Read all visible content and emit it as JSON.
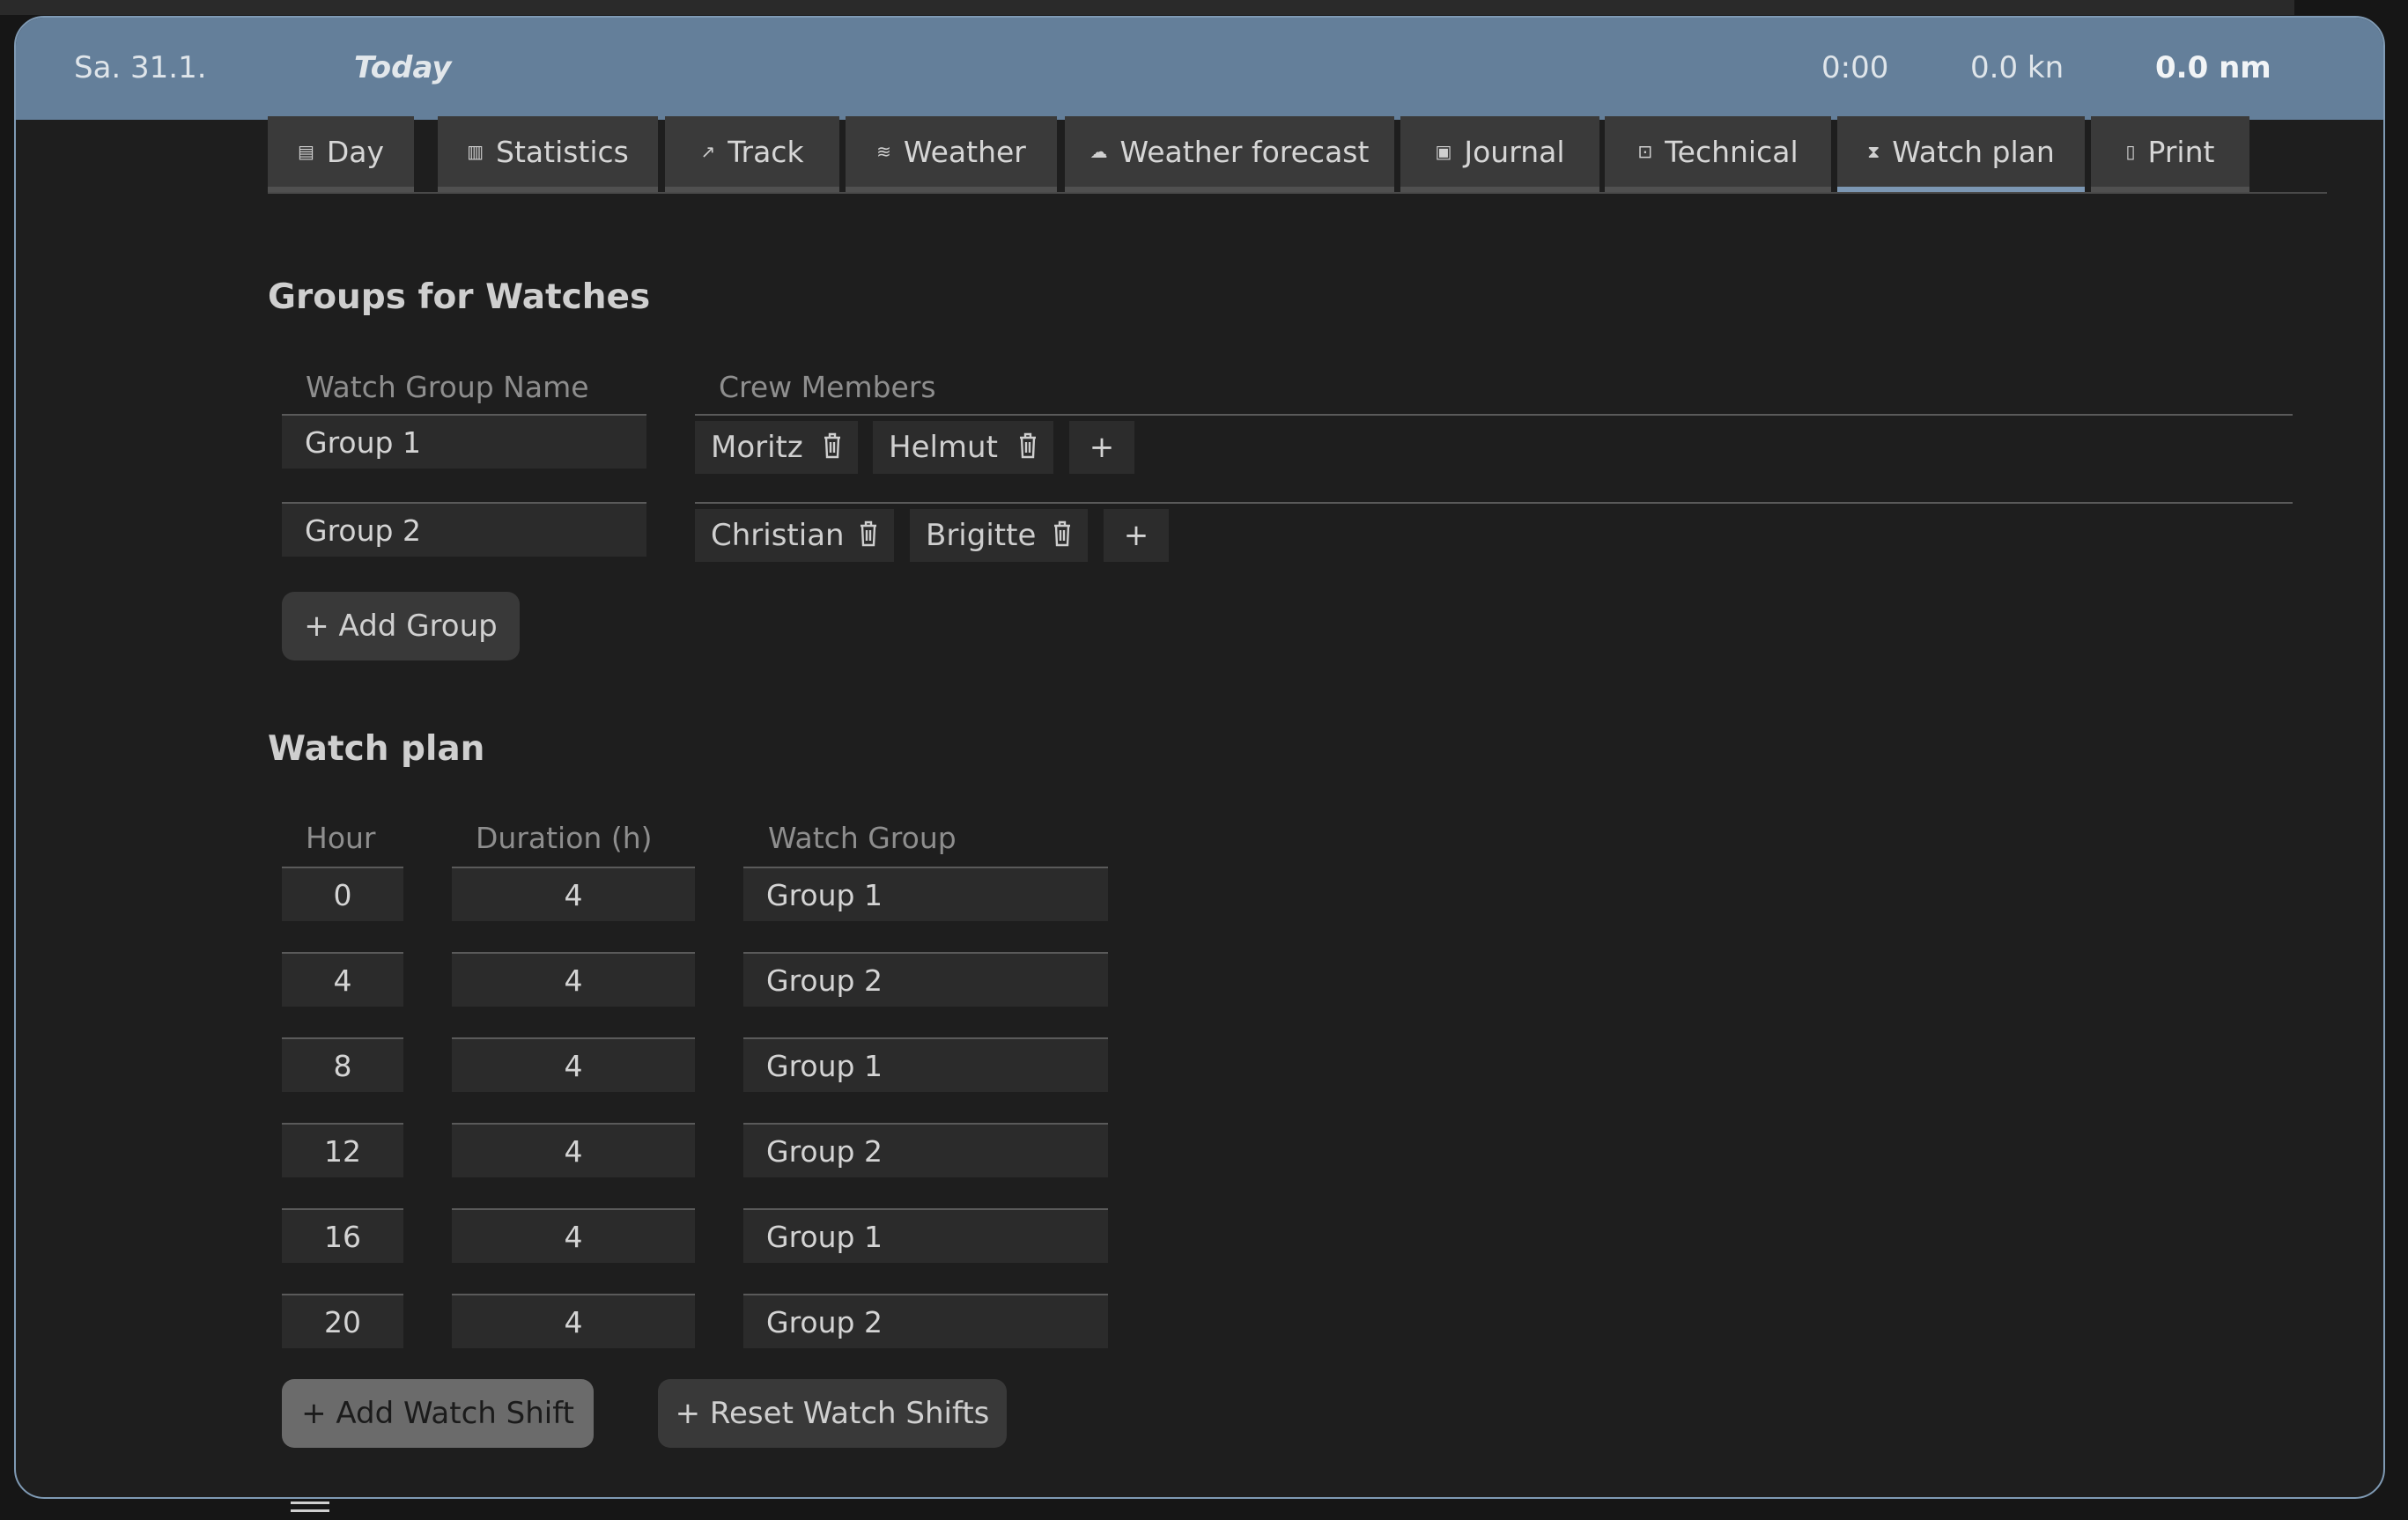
{
  "header": {
    "date": "Sa. 31.1.",
    "today": "Today",
    "time": "0:00",
    "speed": "0.0 kn",
    "distance": "0.0 nm"
  },
  "tabs": [
    {
      "label": "Day",
      "icon": "calendar-icon"
    },
    {
      "label": "Statistics",
      "icon": "bar-chart-icon"
    },
    {
      "label": "Track",
      "icon": "track-icon"
    },
    {
      "label": "Weather",
      "icon": "weather-icon"
    },
    {
      "label": "Weather forecast",
      "icon": "forecast-icon"
    },
    {
      "label": "Journal",
      "icon": "journal-icon"
    },
    {
      "label": "Technical",
      "icon": "technical-icon"
    },
    {
      "label": "Watch plan",
      "icon": "hourglass-icon",
      "active": true
    },
    {
      "label": "Print",
      "icon": "document-icon"
    }
  ],
  "groups_section": {
    "title": "Groups for Watches",
    "col_name": "Watch Group Name",
    "col_members": "Crew Members",
    "groups": [
      {
        "name": "Group 1",
        "members": [
          "Moritz",
          "Helmut"
        ]
      },
      {
        "name": "Group 2",
        "members": [
          "Christian",
          "Brigitte"
        ]
      }
    ],
    "add_member_label": "+",
    "add_group_label": "+ Add Group"
  },
  "watch_plan": {
    "title": "Watch plan",
    "col_hour": "Hour",
    "col_duration": "Duration (h)",
    "col_group": "Watch Group",
    "rows": [
      {
        "hour": "0",
        "duration": "4",
        "group": "Group 1"
      },
      {
        "hour": "4",
        "duration": "4",
        "group": "Group 2"
      },
      {
        "hour": "8",
        "duration": "4",
        "group": "Group 1"
      },
      {
        "hour": "12",
        "duration": "4",
        "group": "Group 2"
      },
      {
        "hour": "16",
        "duration": "4",
        "group": "Group 1"
      },
      {
        "hour": "20",
        "duration": "4",
        "group": "Group 2"
      }
    ],
    "add_shift_label": "+ Add Watch Shift",
    "reset_label": "+ Reset Watch Shifts"
  },
  "colors": {
    "header_bg": "#647f9a",
    "active_tab_accent": "#7c97b3",
    "background": "#1e1e1e"
  }
}
